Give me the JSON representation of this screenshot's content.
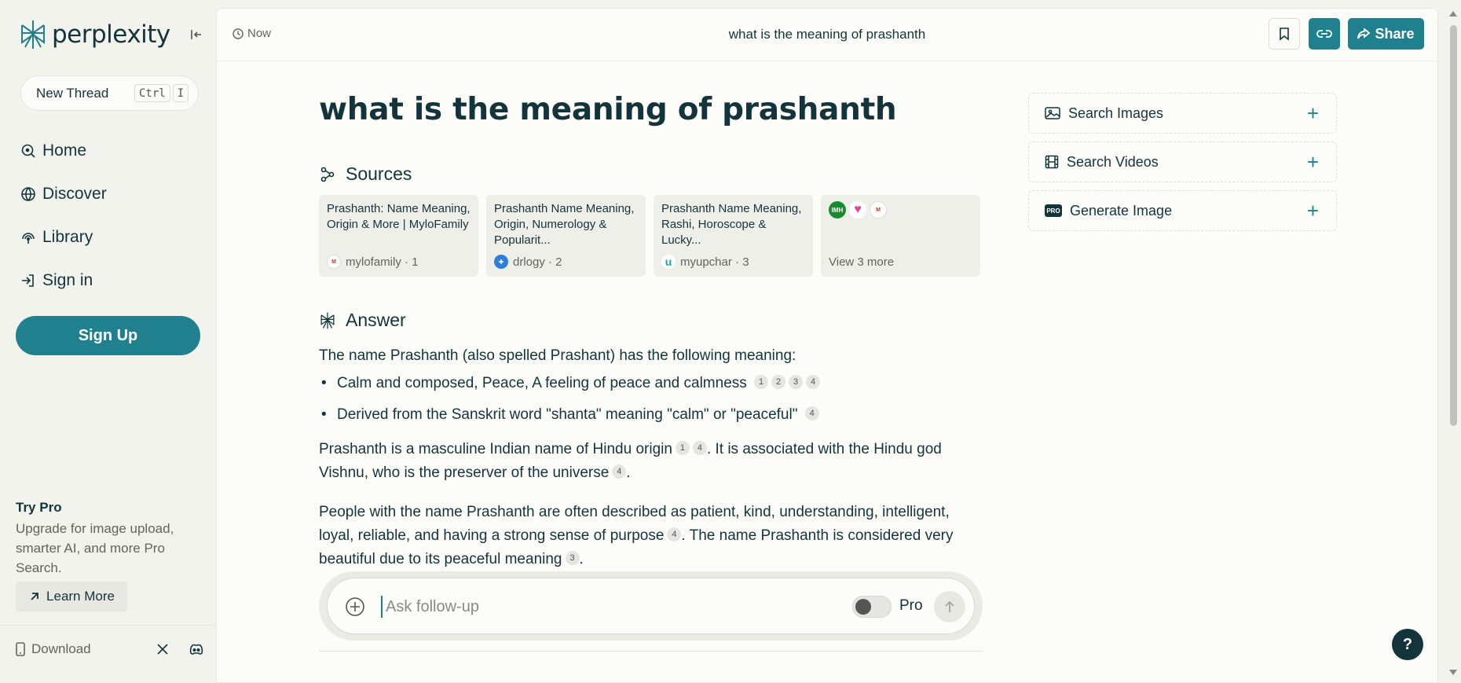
{
  "sidebar": {
    "logo_text": "perplexity",
    "new_thread": {
      "label": "New Thread",
      "kbd1": "Ctrl",
      "kbd2": "I"
    },
    "nav": [
      {
        "label": "Home",
        "icon": "home-search-icon"
      },
      {
        "label": "Discover",
        "icon": "globe-icon"
      },
      {
        "label": "Library",
        "icon": "library-icon"
      },
      {
        "label": "Sign in",
        "icon": "sign-in-icon"
      }
    ],
    "signup_label": "Sign Up",
    "try_pro": {
      "title": "Try Pro",
      "description": "Upgrade for image upload, smarter AI, and more Pro Search.",
      "learn_more": "Learn More"
    },
    "download_label": "Download"
  },
  "header": {
    "time": "Now",
    "title": "what is the meaning of prashanth",
    "share_label": "Share"
  },
  "query": "what is the meaning of prashanth",
  "sources": {
    "heading": "Sources",
    "items": [
      {
        "title": "Prashanth: Name Meaning, Origin & More | MyloFamily",
        "site": "mylofamily · 1"
      },
      {
        "title": "Prashanth Name Meaning, Origin, Numerology & Popularit...",
        "site": "drlogy · 2"
      },
      {
        "title": "Prashanth Name Meaning, Rashi, Horoscope & Lucky...",
        "site": "myupchar · 3"
      }
    ],
    "more_label": "View 3 more"
  },
  "answer": {
    "heading": "Answer",
    "intro": "The name Prashanth (also spelled Prashant) has the following meaning:",
    "bullets": [
      {
        "text": "Calm and composed, Peace, A feeling of peace and calmness",
        "cites": [
          "1",
          "2",
          "3",
          "4"
        ]
      },
      {
        "text": "Derived from the Sanskrit word \"shanta\" meaning \"calm\" or \"peaceful\"",
        "cites": [
          "4"
        ]
      }
    ],
    "p2_a": "Prashanth is a masculine Indian name of Hindu origin",
    "p2_b": ". It is associated with the Hindu god Vishnu, who is the preserver of the universe",
    "p3_a": "People with the name Prashanth are often described as patient, kind, understanding, intelligent, loyal, reliable, and having a strong sense of purpose",
    "p3_b": ". The name Prashanth is considered very beautiful due to its peaceful meaning",
    "cite1": "1",
    "cite3": "3",
    "cite4": "4"
  },
  "followup": {
    "placeholder": "Ask follow-up",
    "pro_label": "Pro"
  },
  "side_actions": [
    {
      "label": "Search Images",
      "icon": "image-icon"
    },
    {
      "label": "Search Videos",
      "icon": "film-icon"
    },
    {
      "label": "Generate Image",
      "icon": "pro-badge-icon"
    }
  ],
  "help_label": "?",
  "colors": {
    "accent": "#20808d",
    "text": "#13343b",
    "background": "#fcfcf9"
  }
}
